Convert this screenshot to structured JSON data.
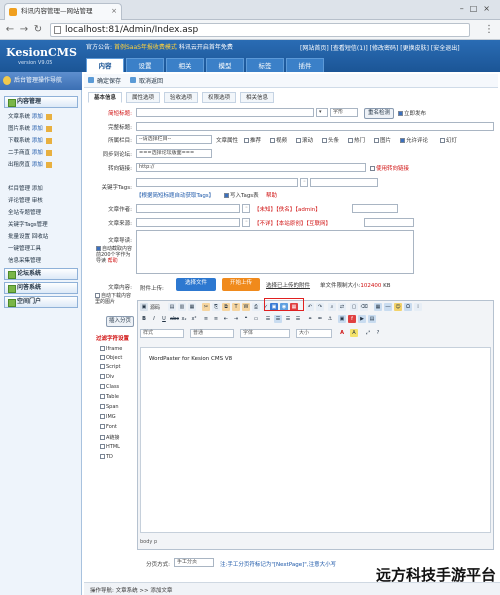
{
  "browser": {
    "tab_title": "科讯内容管理—网站管理",
    "address": "localhost:81/Admin/Index.asp",
    "menu_icon": "three-dots-icon"
  },
  "header": {
    "logo": "KesionCMS",
    "version": "version V9.05",
    "notice_prefix": "官方公告:",
    "notice": "首例SaaS年报收费模式",
    "notice_more": "科讯云开启首年免费",
    "top_links": "[网站首页] [查看短信(1)] [修改密码] [更换皮肤] [安全退出]"
  },
  "nav_tabs": [
    "内容",
    "设置",
    "相关",
    "模型",
    "标签",
    "插件"
  ],
  "sidebar": {
    "title": "后台管理操作导航",
    "section_content": "内容管理",
    "items": [
      {
        "label": "文章系统",
        "add": "添加"
      },
      {
        "label": "图片系统",
        "add": "添加"
      },
      {
        "label": "下载系统",
        "add": "添加"
      },
      {
        "label": "二手商直",
        "add": "添加"
      },
      {
        "label": "出租房直",
        "add": "添加"
      }
    ],
    "items2": [
      "栏目管理 添加",
      "评论管理 审核",
      "全站专题管理",
      "关键字Tags管理",
      "批量设置 回收站",
      "一键管理工具",
      "信息采集管理"
    ],
    "section_forum": "论坛系统",
    "section_ask": "问答系统",
    "section_space": "空间门户"
  },
  "toolbar": {
    "save": "确定保存",
    "cancel": "取消返回"
  },
  "form_tabs": [
    "基本信息",
    "属性选项",
    "验收选项",
    "权限选项",
    "相关信息"
  ],
  "form": {
    "title_label": "简短标题:",
    "title_font": "字形",
    "dup_check": "重名检测",
    "publish_now": "立即发布",
    "full_title_label": "完整标题:",
    "column_label": "所属栏目:",
    "column_value": "--请选择栏目--",
    "attr_label": "文章属性",
    "attrs": [
      "推荐",
      "视频",
      "滚动",
      "头条",
      "热门",
      "图片"
    ],
    "allow_comment": "允许评论",
    "slide": "幻灯",
    "forum_label": "同步到论坛:",
    "forum_value": "===选择论坛版面===",
    "redirect_label": "转向链接:",
    "redirect_value": "http://",
    "use_redirect": "使用转向链接",
    "keywords_label": "关键字Tags:",
    "keywords_hint": "【根据简短标题自动获取Tags】",
    "tags_import": "写入Tags表",
    "help": "帮助",
    "author_label": "文章作者:",
    "author_links": "【未知】【佚名】【admin】",
    "source_label": "文章来源:",
    "source_links": "【不详】【本站原创】【互联网】",
    "intro_label": "文章导读:",
    "auto_intro": "自动截取内容前200个字作为导读",
    "intro_help": "帮助",
    "content_label": "文章内容:",
    "auto_img": "自动下载内容里的图片",
    "insert_page": "插入分页",
    "filter_label": "过滤字符设置",
    "attach_label": "附件上传:",
    "choose_file": "选择文件",
    "start_upload": "开始上传",
    "choose_uploaded": "选择已上传的附件",
    "size_limit_prefix": "单文件限制大小:",
    "size_limit": "102400",
    "size_unit": "KB"
  },
  "editor": {
    "source": "源码",
    "style_label": "样式",
    "format_label": "普通",
    "font_label": "字体",
    "size_label": "大小",
    "content": "WordPaster for Kesion CMS V8",
    "path": "body  p"
  },
  "filter_tags": [
    "Iframe",
    "Object",
    "Script",
    "Div",
    "Class",
    "Table",
    "Span",
    "IMG",
    "Font",
    "A链接",
    "HTML",
    "TD"
  ],
  "paging": {
    "label": "分页方式:",
    "value": "手工分页",
    "hint": "注:手工分页符标记为\"[NextPage]\",注意大小写"
  },
  "statusbar": {
    "text": "操作导航: 文章系统 >> 添加文章"
  },
  "watermark": "远方科技手游平台",
  "colors": {
    "header": "#1b5596",
    "accent_red": "#d01010",
    "upload_blue": "#2d78d0",
    "upload_orange": "#f08a1c"
  }
}
